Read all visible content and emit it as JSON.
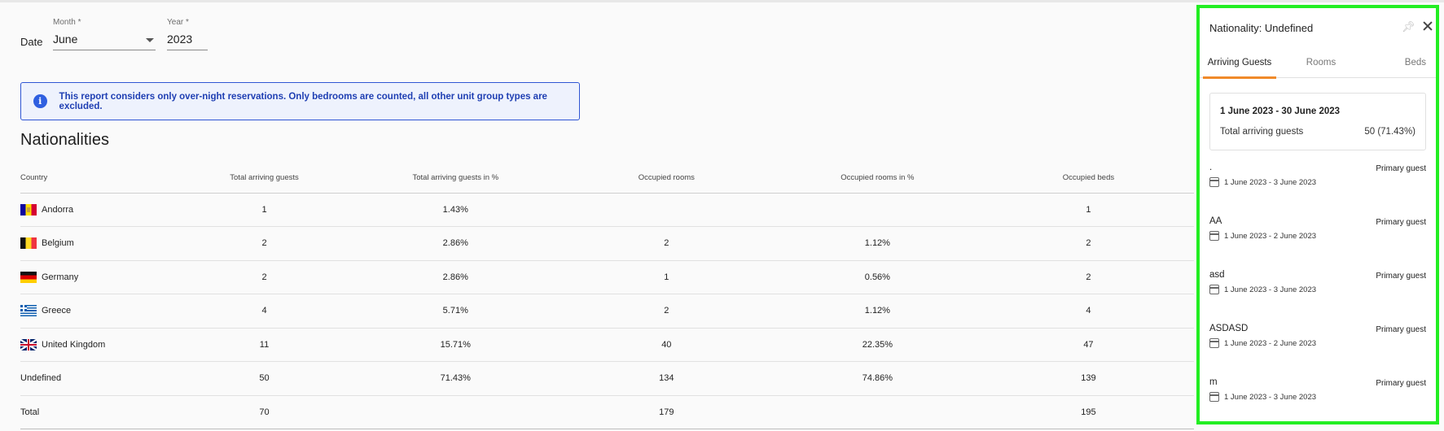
{
  "filters": {
    "date_label": "Date",
    "month": {
      "label": "Month *",
      "value": "June"
    },
    "year": {
      "label": "Year *",
      "value": "2023"
    }
  },
  "info": {
    "icon": "info-icon",
    "text": "This report considers only over-night reservations. Only bedrooms are counted, all other unit group types are excluded."
  },
  "report": {
    "title": "Nationalities",
    "columns": {
      "country": "Country",
      "guests": "Total arriving guests",
      "guests_pct": "Total arriving guests in %",
      "rooms": "Occupied rooms",
      "rooms_pct": "Occupied rooms in %",
      "beds": "Occupied beds"
    },
    "rows": [
      {
        "country": "Andorra",
        "flag": "andorra",
        "guests": "1",
        "guests_pct": "1.43%",
        "rooms": "",
        "rooms_pct": "",
        "beds": "1"
      },
      {
        "country": "Belgium",
        "flag": "belgium",
        "guests": "2",
        "guests_pct": "2.86%",
        "rooms": "2",
        "rooms_pct": "1.12%",
        "beds": "2"
      },
      {
        "country": "Germany",
        "flag": "germany",
        "guests": "2",
        "guests_pct": "2.86%",
        "rooms": "1",
        "rooms_pct": "0.56%",
        "beds": "2"
      },
      {
        "country": "Greece",
        "flag": "greece",
        "guests": "4",
        "guests_pct": "5.71%",
        "rooms": "2",
        "rooms_pct": "1.12%",
        "beds": "4"
      },
      {
        "country": "United Kingdom",
        "flag": "uk",
        "guests": "11",
        "guests_pct": "15.71%",
        "rooms": "40",
        "rooms_pct": "22.35%",
        "beds": "47"
      },
      {
        "country": "Undefined",
        "flag": "",
        "guests": "50",
        "guests_pct": "71.43%",
        "rooms": "134",
        "rooms_pct": "74.86%",
        "beds": "139"
      }
    ],
    "total": {
      "label": "Total",
      "guests": "70",
      "guests_pct": "",
      "rooms": "179",
      "rooms_pct": "",
      "beds": "195"
    }
  },
  "panel": {
    "title": "Nationality: Undefined",
    "tabs": [
      {
        "label": "Arriving Guests",
        "active": true
      },
      {
        "label": "Rooms",
        "active": false
      },
      {
        "label": "Beds",
        "active": false
      }
    ],
    "summary": {
      "range": "1 June 2023 - 30 June 2023",
      "label": "Total arriving guests",
      "value": "50 (71.43%)"
    },
    "guests": [
      {
        "name": ".",
        "type": "Primary guest",
        "dates": "1 June 2023 - 3 June 2023"
      },
      {
        "name": "AA",
        "type": "Primary guest",
        "dates": "1 June 2023 - 2 June 2023"
      },
      {
        "name": "asd",
        "type": "Primary guest",
        "dates": "1 June 2023 - 3 June 2023"
      },
      {
        "name": "ASDASD",
        "type": "Primary guest",
        "dates": "1 June 2023 - 2 June 2023"
      },
      {
        "name": "m",
        "type": "Primary guest",
        "dates": "1 June 2023 - 3 June 2023"
      }
    ],
    "highlight_color": "#22ee22",
    "accent_color": "#f08a2a"
  }
}
